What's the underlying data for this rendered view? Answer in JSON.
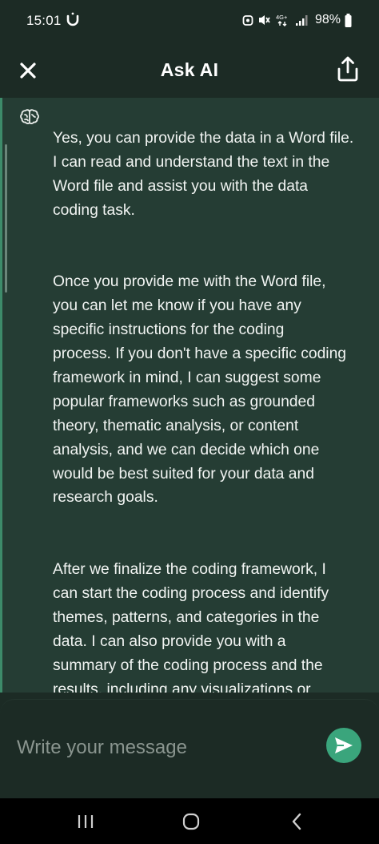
{
  "status_bar": {
    "time": "15:01",
    "battery": "98%",
    "network": "4G+"
  },
  "header": {
    "title": "Ask AI",
    "close_icon": "close-icon",
    "share_icon": "share-icon"
  },
  "chat": {
    "avatar_icon": "brain-icon",
    "message_paragraphs": [
      "Yes, you can provide the data in a Word file.\nI can read and understand the text in the\nWord file and assist you with the data\ncoding task.",
      "Once you provide me with the Word file,\nyou can let me know if you have any\nspecific instructions for the coding\nprocess. If you don't have a specific coding\nframework in mind, I can suggest some\npopular frameworks such as grounded\ntheory, thematic analysis, or content\nanalysis, and we can decide which one\nwould be best suited for your data and\nresearch goals.",
      "After we finalize the coding framework, I\ncan start the coding process and identify\nthemes, patterns, and categories in the\ndata. I can also provide you with a\nsummary of the coding process and the\nresults, including any visualizations or\nreports that may be useful for your\nanalysis."
    ]
  },
  "composer": {
    "placeholder": "Write your message",
    "send_icon": "send-icon"
  },
  "nav": {
    "recents_icon": "recents-icon",
    "home_icon": "home-icon",
    "back_icon": "back-icon"
  },
  "colors": {
    "background": "#1c2b25",
    "chat_background": "#253d34",
    "accent": "#3aa57c",
    "text": "#f1f4f2"
  }
}
